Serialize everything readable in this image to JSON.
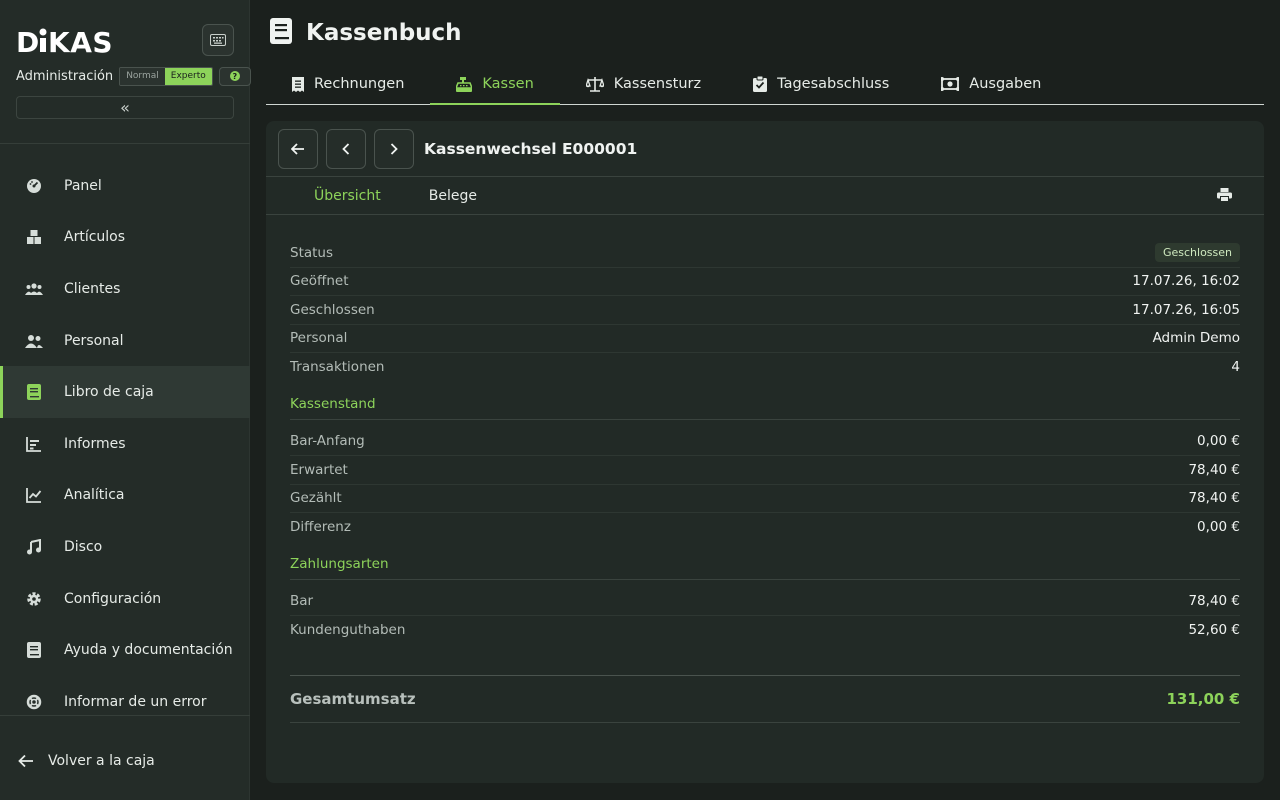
{
  "app": {
    "logo": "DiKAS"
  },
  "sidebar": {
    "admin_label": "Administración",
    "modes": [
      "Normal",
      "Experto"
    ],
    "active_mode": "Experto",
    "items": [
      {
        "label": "Panel",
        "icon": "dashboard-icon"
      },
      {
        "label": "Artículos",
        "icon": "boxes-icon"
      },
      {
        "label": "Clientes",
        "icon": "users-group-icon"
      },
      {
        "label": "Personal",
        "icon": "user-pair-icon"
      },
      {
        "label": "Libro de caja",
        "icon": "book-icon"
      },
      {
        "label": "Informes",
        "icon": "bar-chart-icon"
      },
      {
        "label": "Analítica",
        "icon": "line-chart-icon"
      },
      {
        "label": "Disco",
        "icon": "music-note-icon"
      },
      {
        "label": "Configuración",
        "icon": "gear-icon"
      },
      {
        "label": "Ayuda y documentación",
        "icon": "document-icon"
      },
      {
        "label": "Informar de un error",
        "icon": "lifebuoy-icon"
      }
    ],
    "active_item": "Libro de caja",
    "back_label": "Volver a la caja"
  },
  "header": {
    "title": "Kassenbuch"
  },
  "tabs": [
    {
      "label": "Rechnungen",
      "icon": "receipt-icon"
    },
    {
      "label": "Kassen",
      "icon": "cash-register-icon"
    },
    {
      "label": "Kassensturz",
      "icon": "scale-icon"
    },
    {
      "label": "Tagesabschluss",
      "icon": "clipboard-check-icon"
    },
    {
      "label": "Ausgaben",
      "icon": "money-icon"
    }
  ],
  "active_tab": "Kassen",
  "card": {
    "title": "Kassenwechsel E000001",
    "subtabs": [
      "Übersicht",
      "Belege"
    ],
    "active_subtab": "Übersicht",
    "summary": [
      {
        "label": "Status",
        "value": "Geschlossen",
        "badge": true
      },
      {
        "label": "Geöffnet",
        "value": "17.07.26, 16:02"
      },
      {
        "label": "Geschlossen",
        "value": "17.07.26, 16:05"
      },
      {
        "label": "Personal",
        "value": "Admin Demo"
      },
      {
        "label": "Transaktionen",
        "value": "4"
      }
    ],
    "kassenstand_title": "Kassenstand",
    "kassenstand": [
      {
        "label": "Bar-Anfang",
        "value": "0,00 €"
      },
      {
        "label": "Erwartet",
        "value": "78,40 €"
      },
      {
        "label": "Gezählt",
        "value": "78,40 €"
      },
      {
        "label": "Differenz",
        "value": "0,00 €"
      }
    ],
    "zahlungsarten_title": "Zahlungsarten",
    "zahlungsarten": [
      {
        "label": "Bar",
        "value": "78,40 €"
      },
      {
        "label": "Kundenguthaben",
        "value": "52,60 €"
      }
    ],
    "total_label": "Gesamtumsatz",
    "total_value": "131,00 €"
  },
  "colors": {
    "accent": "#8dd35a",
    "sidebar_bg": "#242c28",
    "page_bg": "#1b201d",
    "card_bg": "#222a26"
  }
}
